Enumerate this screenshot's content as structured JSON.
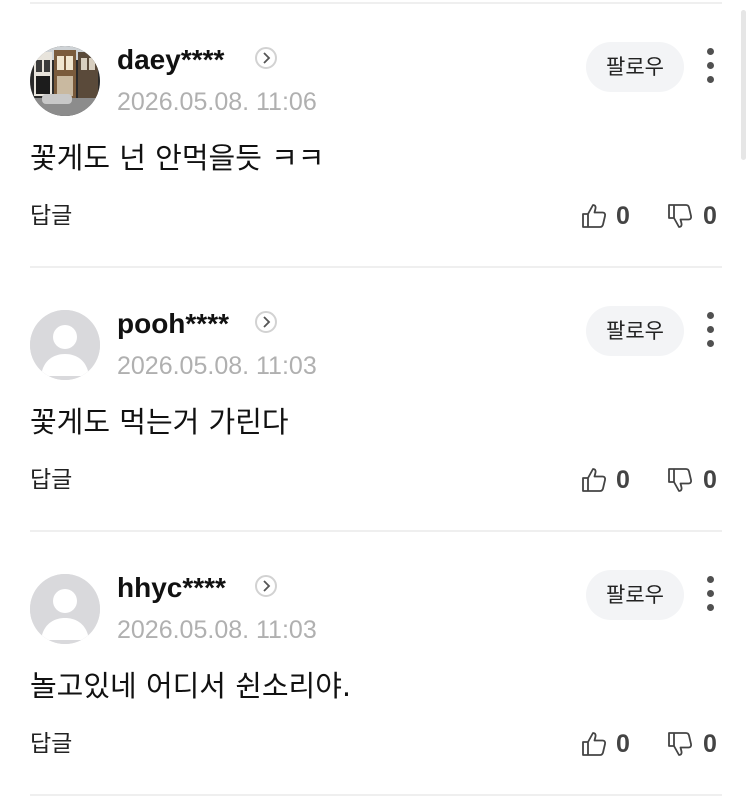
{
  "comments": [
    {
      "avatar": "photo-avatar",
      "username": "daey****",
      "timestamp": "2026.05.08. 11:06",
      "follow_label": "팔로우",
      "content": "꽃게도 넌 안먹을듯 ㅋㅋ",
      "reply_label": "답글",
      "likes": "0",
      "dislikes": "0"
    },
    {
      "avatar": "default-avatar",
      "username": "pooh****",
      "timestamp": "2026.05.08. 11:03",
      "follow_label": "팔로우",
      "content": "꽃게도 먹는거 가린다",
      "reply_label": "답글",
      "likes": "0",
      "dislikes": "0"
    },
    {
      "avatar": "default-avatar",
      "username": "hhyc****",
      "timestamp": "2026.05.08. 11:03",
      "follow_label": "팔로우",
      "content": "놀고있네 어디서 쉰소리야.",
      "reply_label": "답글",
      "likes": "0",
      "dislikes": "0"
    }
  ],
  "colors": {
    "username": "#111111",
    "timestamp": "#b0b0b0",
    "follow_bg": "#f3f4f6",
    "divider": "#efefef",
    "count": "#444444"
  }
}
